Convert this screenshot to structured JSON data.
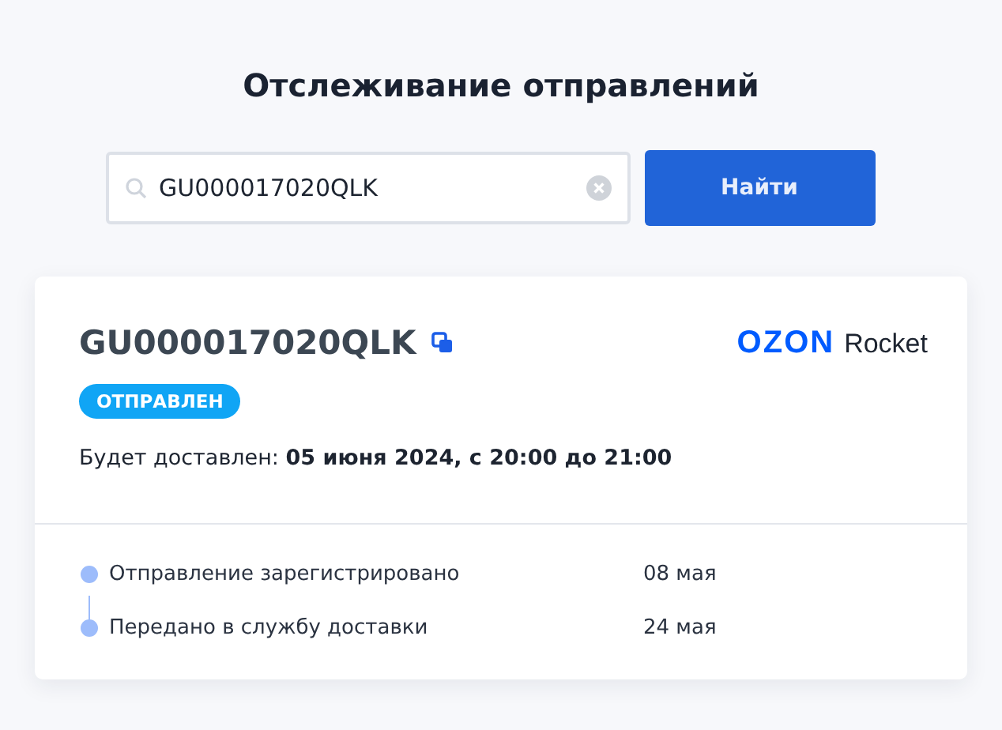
{
  "title": "Отслеживание отправлений",
  "search": {
    "value": "GU000017020QLK",
    "button": "Найти"
  },
  "shipment": {
    "number": "GU000017020QLK",
    "logo": {
      "brand": "OZON",
      "suffix": "Rocket"
    },
    "status": "ОТПРАВЛЕН",
    "delivery_label": "Будет доставлен: ",
    "delivery_value": "05 июня 2024, с 20:00 до 21:00",
    "events": [
      {
        "label": "Отправление зарегистрировано",
        "date": "08 мая"
      },
      {
        "label": "Передано в службу доставки",
        "date": "24 мая"
      }
    ]
  }
}
